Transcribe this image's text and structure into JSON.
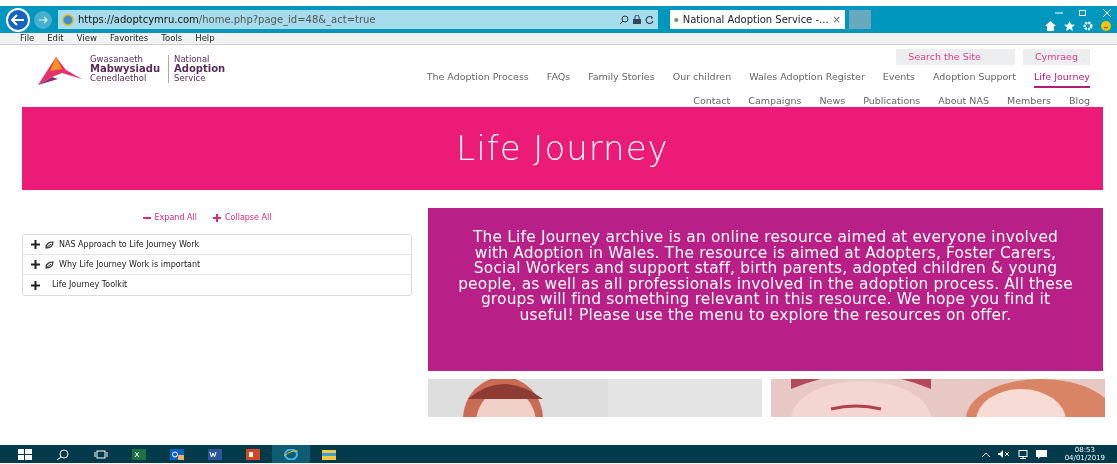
{
  "browser": {
    "url_host": "https://adoptcymru.com",
    "url_path": "/home.php?page_id=48&_act=true",
    "tab_title": "National Adoption Service -...",
    "tab_close": "×",
    "menu": [
      "File",
      "Edit",
      "View",
      "Favorites",
      "Tools",
      "Help"
    ]
  },
  "site": {
    "logo": {
      "welsh": [
        "Gwasanaeth",
        "Mabwysiadu",
        "Cenedlaethol"
      ],
      "english": [
        "National",
        "Adoption",
        "Service"
      ]
    },
    "utility_links": [
      "Search the Site",
      "Cymraeg"
    ],
    "nav_primary": [
      {
        "label": "The Adoption Process",
        "selected": false
      },
      {
        "label": "FAQs",
        "selected": false
      },
      {
        "label": "Family Stories",
        "selected": false
      },
      {
        "label": "Our children",
        "selected": false
      },
      {
        "label": "Wales Adoption Register",
        "selected": false
      },
      {
        "label": "Events",
        "selected": false
      },
      {
        "label": "Adoption Support",
        "selected": false
      },
      {
        "label": "Life Journey",
        "selected": true
      }
    ],
    "nav_secondary": [
      "Contact",
      "Campaigns",
      "News",
      "Publications",
      "About NAS",
      "Members",
      "Blog"
    ]
  },
  "banner": {
    "title": "Life Journey"
  },
  "controls": [
    {
      "kind": "minus",
      "label": "Expand All"
    },
    {
      "kind": "plus",
      "label": "Collapse All"
    }
  ],
  "accordion": [
    {
      "label": "NAS Approach to Life Journey Work",
      "kind": "leaf",
      "expanded": false
    },
    {
      "label": "Why Life Journey Work is important",
      "kind": "leaf",
      "expanded": false
    },
    {
      "label": "Life Journey Toolkit",
      "kind": "plain",
      "expanded": false
    }
  ],
  "intro": "The Life Journey archive is an online resource aimed at everyone involved with Adoption in Wales. The resource is aimed at Adopters, Foster Carers, Social Workers and support staff, birth parents, adopted children & young people, as well as all professionals involved in the adoption process. All these groups will find something relevant in this resource. We hope you find it useful! Please use the menu to explore the resources on offer.",
  "taskbar": {
    "apps": [
      {
        "selected": false
      },
      {
        "selected": false
      },
      {
        "selected": false
      },
      {
        "selected": false
      },
      {
        "selected": true
      },
      {
        "selected": false
      }
    ],
    "time": "08:53",
    "date": "04/01/2019"
  }
}
